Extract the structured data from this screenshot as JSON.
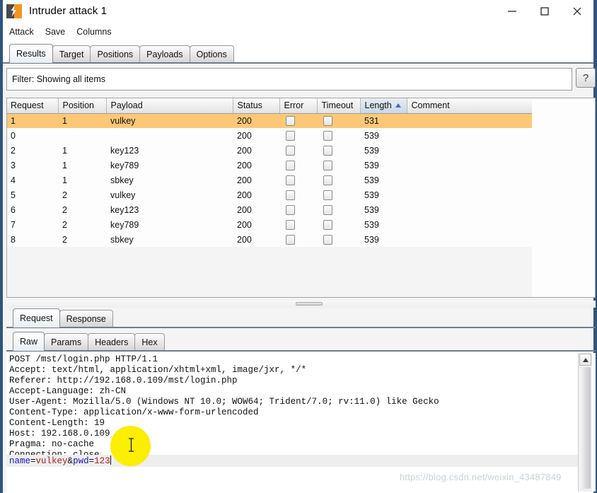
{
  "window": {
    "title": "Intruder attack 1",
    "app_icon": "burp-suite-icon",
    "minimize_label": "minimize-icon",
    "maximize_label": "maximize-icon",
    "close_label": "close-icon"
  },
  "menubar": {
    "items": [
      {
        "label": "Attack"
      },
      {
        "label": "Save"
      },
      {
        "label": "Columns"
      }
    ]
  },
  "tabs": {
    "items": [
      {
        "label": "Results",
        "active": true
      },
      {
        "label": "Target",
        "active": false
      },
      {
        "label": "Positions",
        "active": false
      },
      {
        "label": "Payloads",
        "active": false
      },
      {
        "label": "Options",
        "active": false
      }
    ]
  },
  "filter": {
    "text": "Filter: Showing all items",
    "help_label": "?"
  },
  "results_table": {
    "columns": [
      {
        "label": "Request",
        "sorted": false
      },
      {
        "label": "Position",
        "sorted": false
      },
      {
        "label": "Payload",
        "sorted": false
      },
      {
        "label": "Status",
        "sorted": false
      },
      {
        "label": "Error",
        "sorted": false
      },
      {
        "label": "Timeout",
        "sorted": false
      },
      {
        "label": "Length",
        "sorted": true,
        "sort_direction": "ascending"
      },
      {
        "label": "Comment",
        "sorted": false
      }
    ],
    "rows": [
      {
        "request": "1",
        "position": "1",
        "payload": "vulkey",
        "status": "200",
        "error": false,
        "timeout": false,
        "length": "531",
        "comment": "",
        "selected": true
      },
      {
        "request": "0",
        "position": "",
        "payload": "",
        "status": "200",
        "error": false,
        "timeout": false,
        "length": "539",
        "comment": "",
        "selected": false
      },
      {
        "request": "2",
        "position": "1",
        "payload": "key123",
        "status": "200",
        "error": false,
        "timeout": false,
        "length": "539",
        "comment": "",
        "selected": false
      },
      {
        "request": "3",
        "position": "1",
        "payload": "key789",
        "status": "200",
        "error": false,
        "timeout": false,
        "length": "539",
        "comment": "",
        "selected": false
      },
      {
        "request": "4",
        "position": "1",
        "payload": "sbkey",
        "status": "200",
        "error": false,
        "timeout": false,
        "length": "539",
        "comment": "",
        "selected": false
      },
      {
        "request": "5",
        "position": "2",
        "payload": "vulkey",
        "status": "200",
        "error": false,
        "timeout": false,
        "length": "539",
        "comment": "",
        "selected": false
      },
      {
        "request": "6",
        "position": "2",
        "payload": "key123",
        "status": "200",
        "error": false,
        "timeout": false,
        "length": "539",
        "comment": "",
        "selected": false
      },
      {
        "request": "7",
        "position": "2",
        "payload": "key789",
        "status": "200",
        "error": false,
        "timeout": false,
        "length": "539",
        "comment": "",
        "selected": false
      },
      {
        "request": "8",
        "position": "2",
        "payload": "sbkey",
        "status": "200",
        "error": false,
        "timeout": false,
        "length": "539",
        "comment": "",
        "selected": false
      }
    ]
  },
  "detail_tabs": {
    "items": [
      {
        "label": "Request",
        "active": true
      },
      {
        "label": "Response",
        "active": false
      }
    ]
  },
  "view_tabs": {
    "items": [
      {
        "label": "Raw",
        "active": true
      },
      {
        "label": "Params",
        "active": false
      },
      {
        "label": "Headers",
        "active": false
      },
      {
        "label": "Hex",
        "active": false
      }
    ]
  },
  "request_editor": {
    "headers_text": "POST /mst/login.php HTTP/1.1\nAccept: text/html, application/xhtml+xml, image/jxr, */*\nReferer: http://192.168.0.109/mst/login.php\nAccept-Language: zh-CN\nUser-Agent: Mozilla/5.0 (Windows NT 10.0; WOW64; Trident/7.0; rv:11.0) like Gecko\nContent-Type: application/x-www-form-urlencoded\nContent-Length: 19\nHost: 192.168.0.109\nPragma: no-cache\nConnection: close",
    "body": {
      "param1_name": "name",
      "param1_sep": "=",
      "param1_value": "vulkey",
      "amp": "&",
      "param2_name": "pwd",
      "param2_sep": "=",
      "param2_value": "123"
    }
  },
  "watermark": {
    "text": "https://blog.csdn.net/weixin_43487849"
  },
  "colors": {
    "selected_row": "#fcc878",
    "accent_orange": "#f7941e",
    "sort_indicator": "#4a6fa5",
    "param_name": "#1414c8",
    "param_value": "#b02020",
    "click_highlight": "#fbee00",
    "window_border": "#2f5480"
  }
}
